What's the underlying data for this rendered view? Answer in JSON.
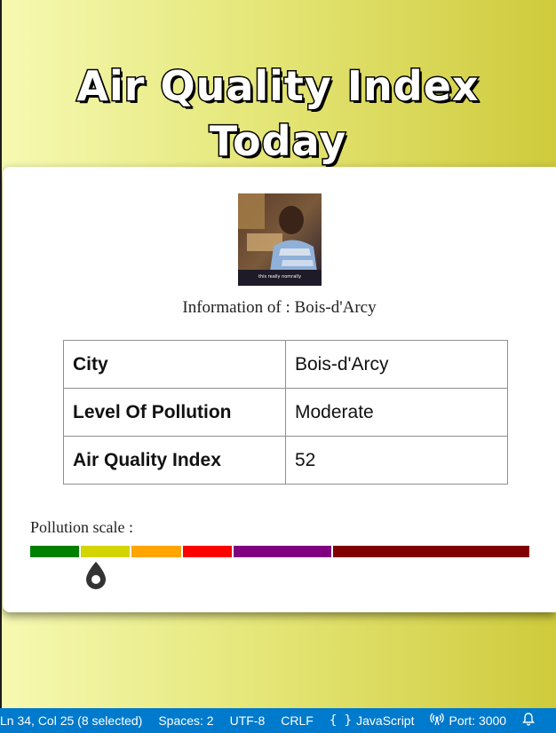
{
  "title": {
    "line1": "Air Quality Index",
    "line2": "Today"
  },
  "info": {
    "prefix": "Information of : ",
    "city": "Bois-d'Arcy",
    "photo_caption": "this really nomrally"
  },
  "table": [
    {
      "key": "City",
      "value": "Bois-d'Arcy"
    },
    {
      "key": "Level Of Pollution",
      "value": "Moderate"
    },
    {
      "key": "Air Quality Index",
      "value": "52"
    }
  ],
  "scale": {
    "label": "Pollution scale :",
    "aqi_value": 52,
    "scale_max": 500,
    "segments": [
      {
        "color": "#008000",
        "from": 0,
        "to": 50
      },
      {
        "color": "#d4d400",
        "from": 50,
        "to": 100
      },
      {
        "color": "#ffa500",
        "from": 100,
        "to": 150
      },
      {
        "color": "#ff0000",
        "from": 150,
        "to": 200
      },
      {
        "color": "#800080",
        "from": 200,
        "to": 300
      },
      {
        "color": "#800000",
        "from": 300,
        "to": 500
      }
    ]
  },
  "statusbar": {
    "position": "Ln 34, Col 25 (8 selected)",
    "spaces": "Spaces: 2",
    "encoding": "UTF-8",
    "eol": "CRLF",
    "language_icon": "{ }",
    "language": "JavaScript",
    "port": "Port: 3000"
  },
  "colors": {
    "statusbar_bg": "#007acc",
    "bg_left": "#f6f9b2",
    "bg_right": "#cfcb3c"
  }
}
